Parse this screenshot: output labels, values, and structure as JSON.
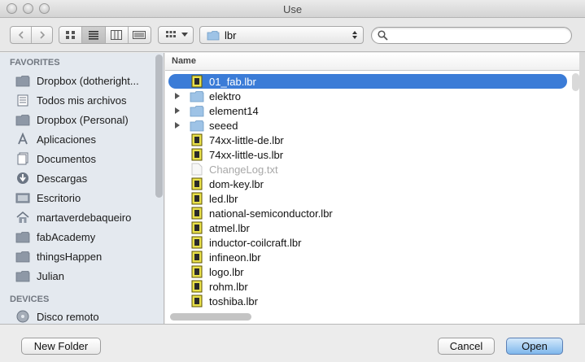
{
  "window": {
    "title": "Use"
  },
  "toolbar": {
    "path_popup": "lbr",
    "search_placeholder": ""
  },
  "sidebar": {
    "favorites_label": "FAVORITES",
    "favorites": [
      {
        "label": "Dropbox (dotheright...",
        "icon": "folder-icon"
      },
      {
        "label": "Todos mis archivos",
        "icon": "all-files-icon"
      },
      {
        "label": "Dropbox (Personal)",
        "icon": "folder-icon"
      },
      {
        "label": "Aplicaciones",
        "icon": "applications-icon"
      },
      {
        "label": "Documentos",
        "icon": "documents-icon"
      },
      {
        "label": "Descargas",
        "icon": "downloads-icon"
      },
      {
        "label": "Escritorio",
        "icon": "desktop-icon"
      },
      {
        "label": "martaverdebaqueiro",
        "icon": "home-icon"
      },
      {
        "label": "fabAcademy",
        "icon": "folder-icon"
      },
      {
        "label": "thingsHappen",
        "icon": "folder-icon"
      },
      {
        "label": "Julian",
        "icon": "folder-icon"
      }
    ],
    "devices_label": "DEVICES",
    "devices": [
      {
        "label": "Disco remoto",
        "icon": "disc-icon"
      }
    ]
  },
  "filelist": {
    "column_name": "Name",
    "rows": [
      {
        "name": "01_fab.lbr",
        "kind": "lbr",
        "selected": true
      },
      {
        "name": "elektro",
        "kind": "folder"
      },
      {
        "name": "element14",
        "kind": "folder"
      },
      {
        "name": "seeed",
        "kind": "folder"
      },
      {
        "name": "74xx-little-de.lbr",
        "kind": "lbr"
      },
      {
        "name": "74xx-little-us.lbr",
        "kind": "lbr"
      },
      {
        "name": "ChangeLog.txt",
        "kind": "txt",
        "disabled": true
      },
      {
        "name": "dom-key.lbr",
        "kind": "lbr"
      },
      {
        "name": "led.lbr",
        "kind": "lbr"
      },
      {
        "name": "national-semiconductor.lbr",
        "kind": "lbr"
      },
      {
        "name": "atmel.lbr",
        "kind": "lbr"
      },
      {
        "name": "inductor-coilcraft.lbr",
        "kind": "lbr"
      },
      {
        "name": "infineon.lbr",
        "kind": "lbr"
      },
      {
        "name": "logo.lbr",
        "kind": "lbr"
      },
      {
        "name": "rohm.lbr",
        "kind": "lbr"
      },
      {
        "name": "toshiba.lbr",
        "kind": "lbr"
      }
    ]
  },
  "buttons": {
    "new_folder": "New Folder",
    "cancel": "Cancel",
    "open": "Open"
  },
  "colors": {
    "selection": "#3b7cd7",
    "sidebar_bg": "#e4e9ef",
    "window_bg": "#ececec"
  }
}
